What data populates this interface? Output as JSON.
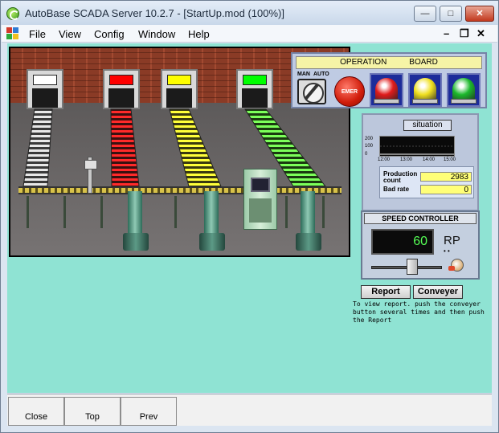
{
  "window": {
    "title": "AutoBase SCADA Server 10.2.7 - [StartUp.mod (100%)]"
  },
  "menu": {
    "items": [
      "File",
      "View",
      "Config",
      "Window",
      "Help"
    ]
  },
  "operation_board": {
    "title_left": "OPERATION",
    "title_right": "BOARD",
    "man_label": "MAN",
    "auto_label": "AUTO",
    "emergency_label": "EMER",
    "beacon_colors": [
      "#e01c1c",
      "#f0e020",
      "#1cb82c"
    ]
  },
  "factory": {
    "door_light_colors": [
      "#ffffff",
      "#ff0000",
      "#ffff00",
      "#00ff00"
    ]
  },
  "situation": {
    "title": "situation",
    "y_ticks": [
      "200",
      "100",
      "0"
    ],
    "x_ticks": [
      "12:00",
      "13:00",
      "14:00",
      "15:00"
    ],
    "production_label": "Production count",
    "production_value": "2983",
    "bad_rate_label": "Bad rate",
    "bad_rate_value": "0"
  },
  "speed": {
    "title": "SPEED CONTROLLER",
    "value": "60",
    "unit": "RP",
    "dots": "• •",
    "slider_level": 0.6
  },
  "actions": {
    "report_label": "Report",
    "conveyer_label": "Conveyer"
  },
  "note": "To view report. push the conveyer button several times and then push the Report",
  "bottom": {
    "close_label": "Close",
    "top_label": "Top",
    "prev_label": "Prev"
  },
  "colors": {
    "client_bg": "#8fe3d3",
    "display_green": "#55ff55"
  }
}
